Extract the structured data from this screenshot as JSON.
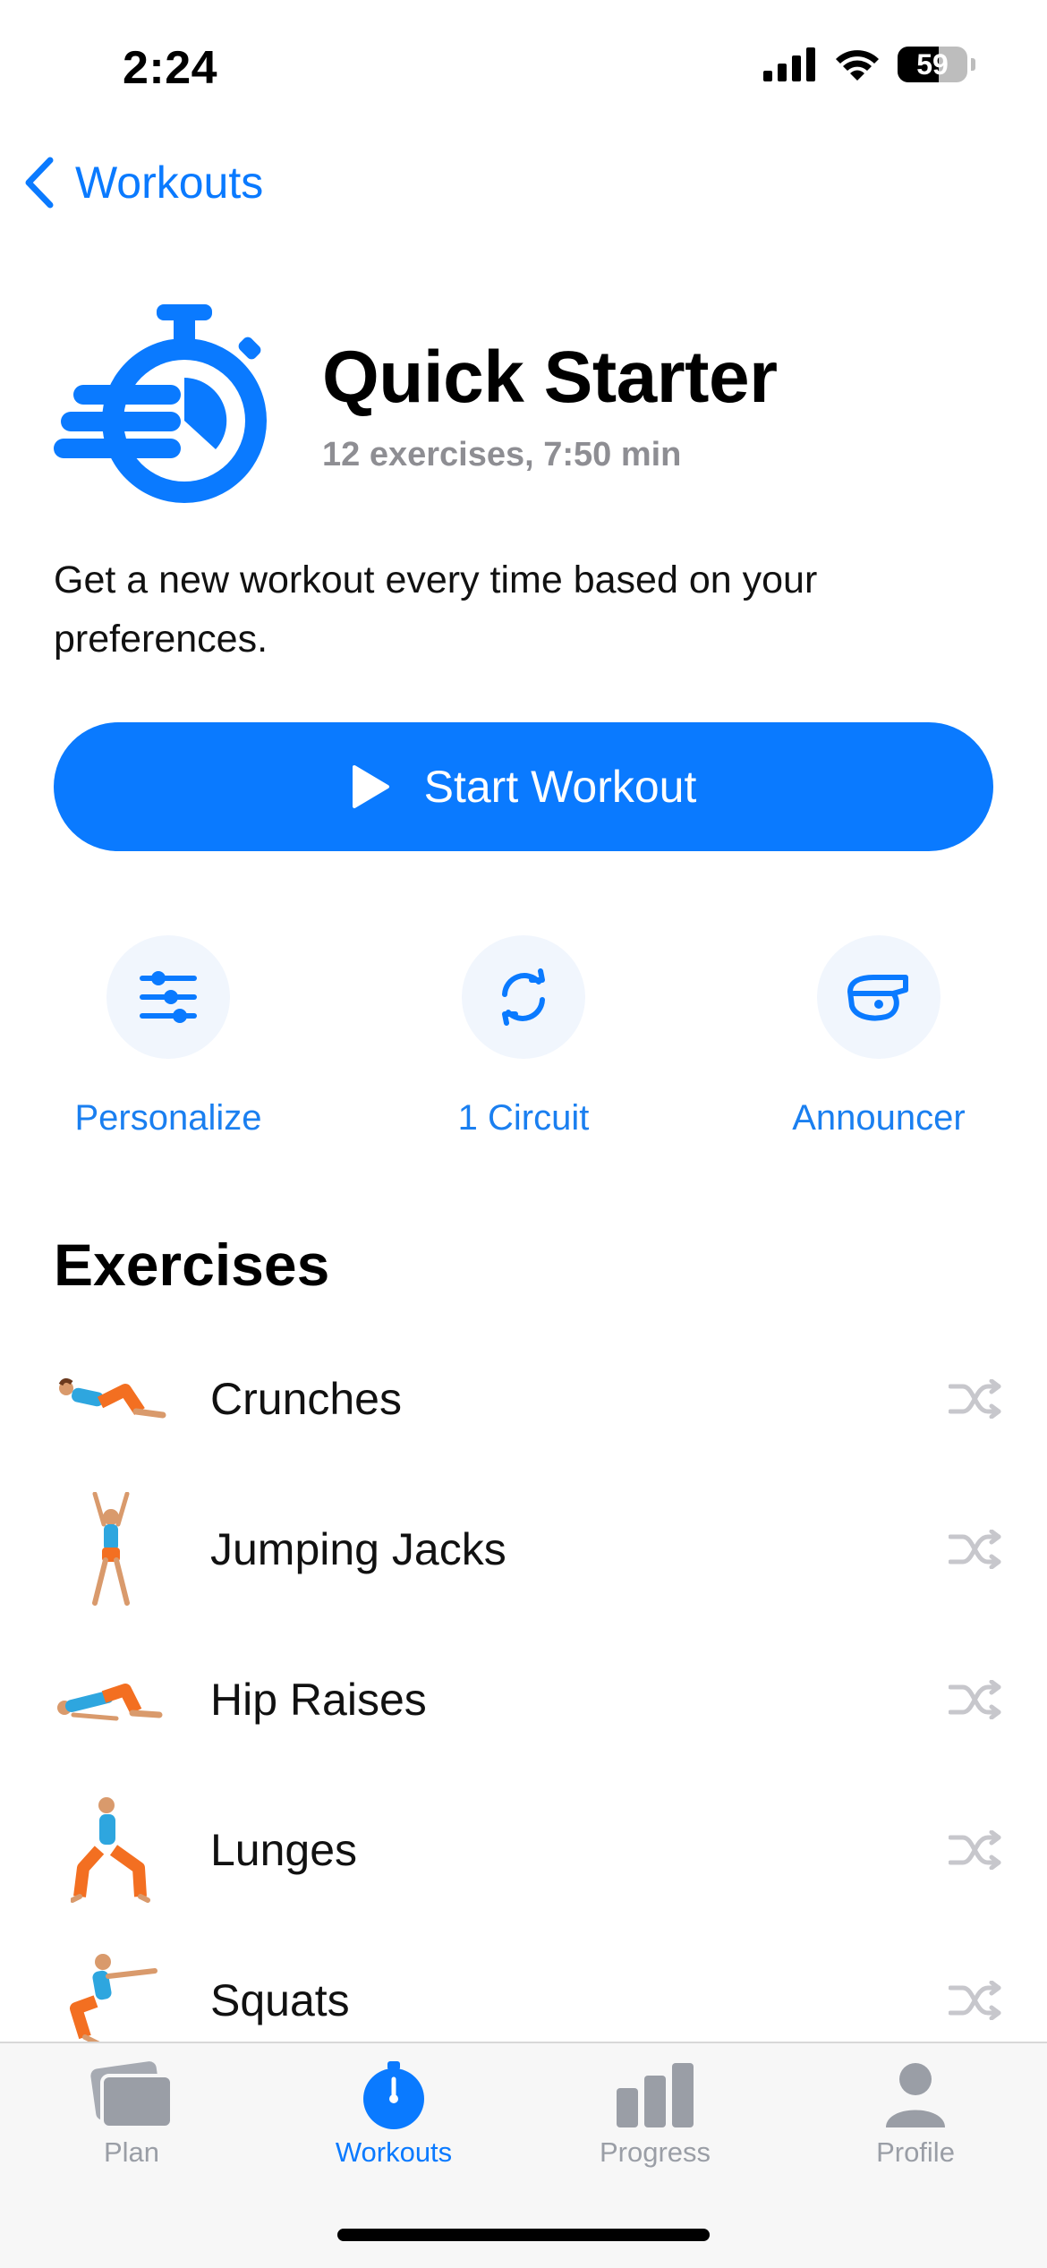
{
  "status": {
    "time": "2:24",
    "battery": "59",
    "battery_level": 0.59
  },
  "nav": {
    "back_label": "Workouts"
  },
  "workout": {
    "title": "Quick Starter",
    "subtitle": "12 exercises, 7:50 min",
    "description": "Get a new workout every time based on your preferences.",
    "start_label": "Start Workout"
  },
  "actions": [
    {
      "label": "Personalize",
      "icon": "sliders-icon"
    },
    {
      "label": "1 Circuit",
      "icon": "repeat-icon"
    },
    {
      "label": "Announcer",
      "icon": "whistle-icon"
    }
  ],
  "exercises_title": "Exercises",
  "exercises": [
    {
      "name": "Crunches"
    },
    {
      "name": "Jumping Jacks"
    },
    {
      "name": "Hip Raises"
    },
    {
      "name": "Lunges"
    },
    {
      "name": "Squats"
    }
  ],
  "tabs": [
    {
      "label": "Plan",
      "icon": "cards-icon",
      "active": false
    },
    {
      "label": "Workouts",
      "icon": "stopwatch-icon",
      "active": true
    },
    {
      "label": "Progress",
      "icon": "bar-chart-icon",
      "active": false
    },
    {
      "label": "Profile",
      "icon": "person-icon",
      "active": false
    }
  ],
  "colors": {
    "accent": "#0a7aff",
    "inactive": "#9a9ea6",
    "shuffle": "#c7c7cc"
  }
}
